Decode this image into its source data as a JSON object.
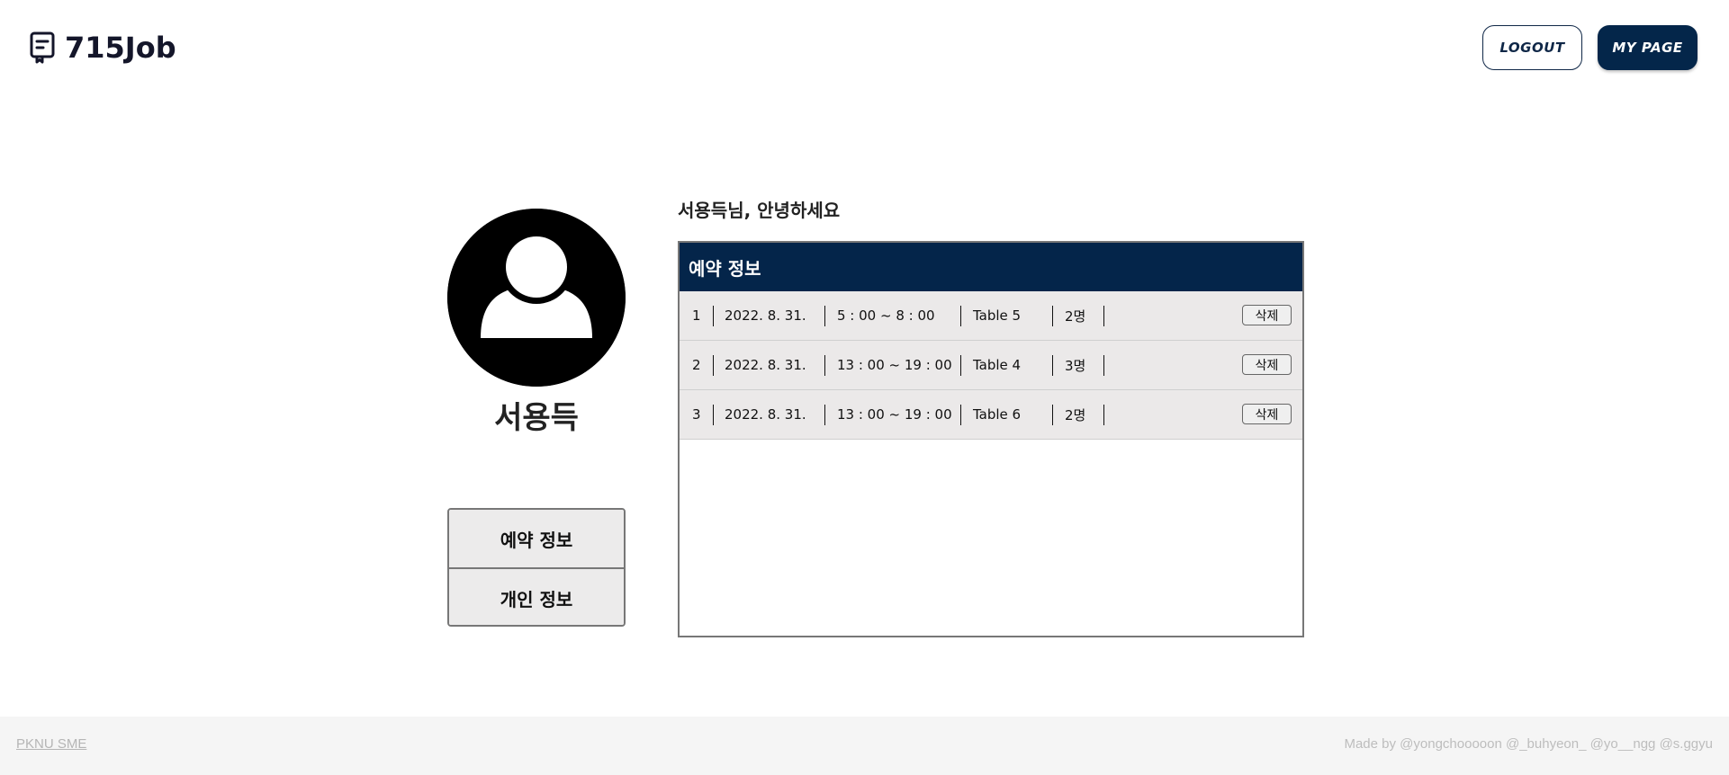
{
  "header": {
    "brand": "715Job",
    "brand_icon": "receipt-icon",
    "logout_label": "LOGOUT",
    "mypage_label": "MY PAGE"
  },
  "profile": {
    "avatar_icon": "user-avatar-icon",
    "name": "서용득"
  },
  "side_menu": {
    "items": [
      {
        "label": "예약 정보"
      },
      {
        "label": "개인 정보"
      }
    ]
  },
  "main": {
    "greeting": "서용득님, 안녕하세요",
    "panel_title": "예약 정보",
    "reservations": [
      {
        "no": "1",
        "date": "2022. 8. 31.",
        "time": "5 : 00 ~ 8 : 00",
        "table": "Table 5",
        "people": "2명",
        "delete_label": "삭제"
      },
      {
        "no": "2",
        "date": "2022. 8. 31.",
        "time": "13 : 00 ~ 19 : 00",
        "table": "Table 4",
        "people": "3명",
        "delete_label": "삭제"
      },
      {
        "no": "3",
        "date": "2022. 8. 31.",
        "time": "13 : 00 ~ 19 : 00",
        "table": "Table 6",
        "people": "2명",
        "delete_label": "삭제"
      }
    ]
  },
  "footer": {
    "link": "PKNU SME",
    "credit": "Made by @yongchooooon @_buhyeon_ @yo__ngg @s.ggyu"
  },
  "colors": {
    "navy": "#04254a",
    "row_bg": "#ebe9e9",
    "footer_bg": "#f5f5f5"
  }
}
